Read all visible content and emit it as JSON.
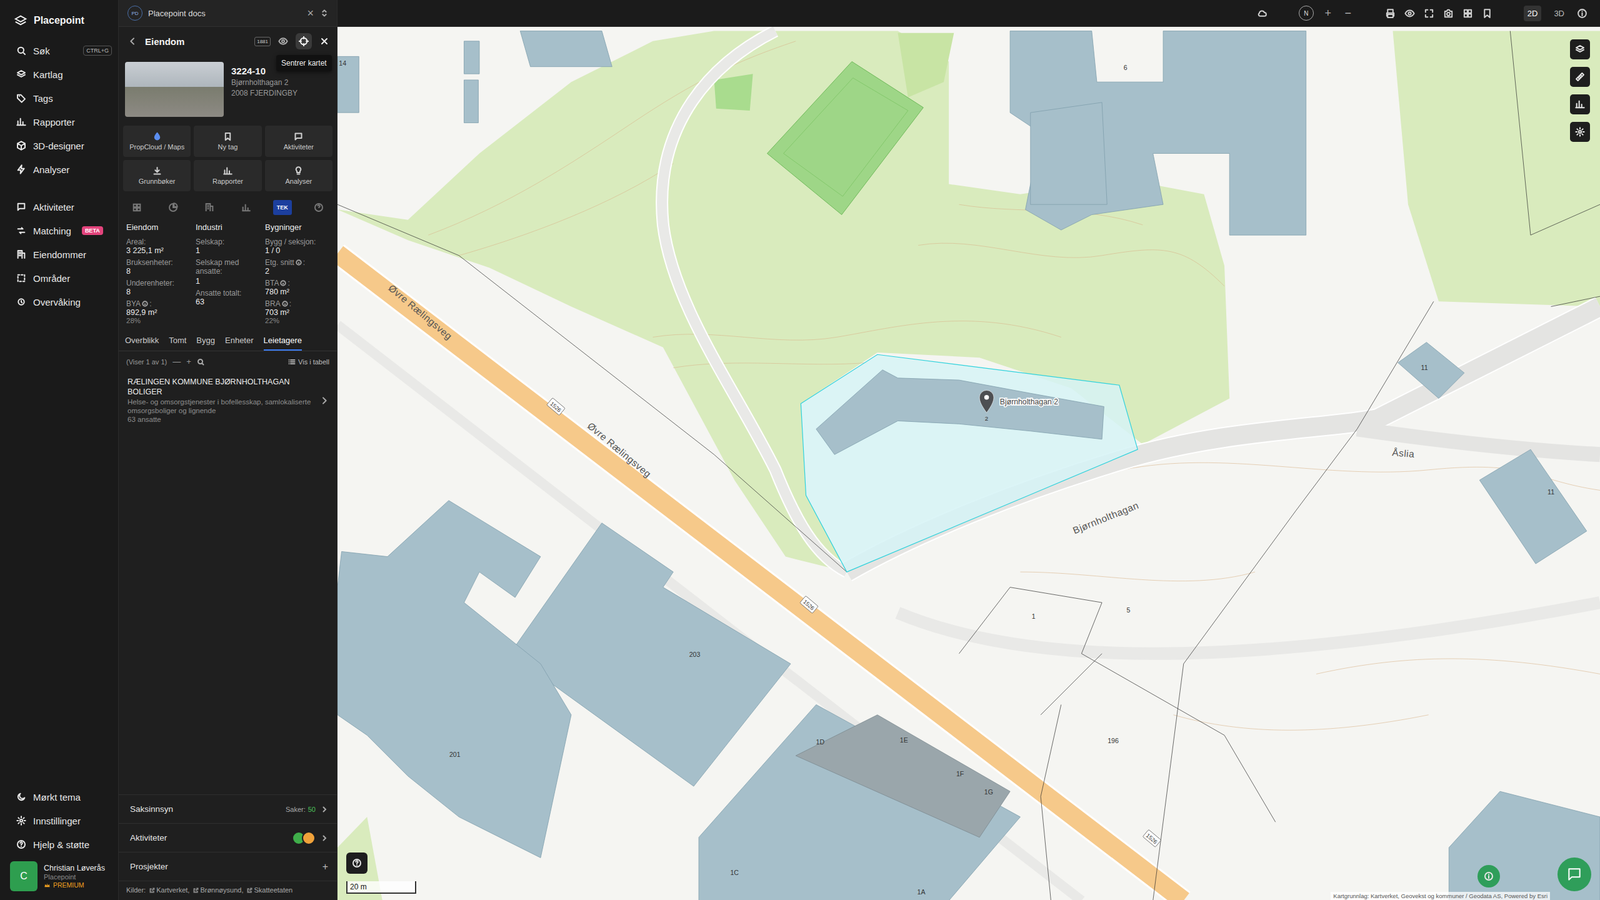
{
  "app": {
    "name": "Placepoint"
  },
  "nav": {
    "main": [
      {
        "label": "Søk",
        "shortcut": "CTRL+G",
        "selected": false
      },
      {
        "label": "Kartlag",
        "shortcut": "",
        "selected": false
      },
      {
        "label": "Tags",
        "shortcut": "",
        "selected": false
      },
      {
        "label": "Rapporter",
        "shortcut": "",
        "selected": false
      },
      {
        "label": "3D-designer",
        "shortcut": "",
        "selected": false
      },
      {
        "label": "Analyser",
        "shortcut": "",
        "selected": false
      }
    ],
    "secondary": [
      {
        "label": "Aktiviteter",
        "badge": "",
        "selected": false
      },
      {
        "label": "Matching",
        "badge": "BETA",
        "selected": false
      },
      {
        "label": "Eiendommer",
        "badge": "",
        "selected": false
      },
      {
        "label": "Områder",
        "badge": "",
        "selected": false
      },
      {
        "label": "Overvåking",
        "badge": "",
        "selected": false
      }
    ],
    "footer": [
      {
        "label": "Mørkt tema",
        "selected": false
      },
      {
        "label": "Innstillinger",
        "selected": false
      },
      {
        "label": "Hjelp & støtte",
        "selected": false
      }
    ],
    "user": {
      "initial": "C",
      "name": "Christian Løverås",
      "org": "Placepoint",
      "plan": "PREMIUM"
    }
  },
  "panel_tab": {
    "badge": "PD",
    "title": "Placepoint docs",
    "close": "×"
  },
  "header": {
    "title": "Eiendom",
    "badge": "1881",
    "tooltip": "Sentrer kartet"
  },
  "property": {
    "id": "3224-10",
    "address": "Bjørnholthagan 2",
    "postal": "2008 FJERDINGBY"
  },
  "actions": [
    {
      "label": "PropCloud / Maps"
    },
    {
      "label": "Ny tag"
    },
    {
      "label": "Aktiviteter"
    },
    {
      "label": "Grunnbøker"
    },
    {
      "label": "Rapporter"
    },
    {
      "label": "Analyser"
    }
  ],
  "source_tabs": [
    {
      "kind": "icon",
      "label": "",
      "selected": false
    },
    {
      "kind": "icon",
      "label": "",
      "selected": false
    },
    {
      "kind": "icon",
      "label": "",
      "selected": false
    },
    {
      "kind": "icon",
      "label": "",
      "selected": false
    },
    {
      "kind": "text",
      "label": "TEK",
      "selected": true
    },
    {
      "kind": "icon",
      "label": "",
      "selected": false
    }
  ],
  "stats": [
    {
      "title": "Eiendom",
      "rows": [
        {
          "label": "Areal:",
          "info": false,
          "after": "",
          "value": "3 225,1 m²",
          "sub": ""
        },
        {
          "label": "Bruksenheter:",
          "info": false,
          "after": "",
          "value": "8",
          "sub": ""
        },
        {
          "label": "Underenheter:",
          "info": false,
          "after": "",
          "value": "8",
          "sub": ""
        },
        {
          "label": "BYA",
          "info": true,
          "after": ":",
          "value": "892,9 m²",
          "sub": "28%"
        }
      ]
    },
    {
      "title": "Industri",
      "rows": [
        {
          "label": "Selskap:",
          "info": false,
          "after": "",
          "value": "1",
          "sub": ""
        },
        {
          "label": "Selskap med ansatte:",
          "info": false,
          "after": "",
          "value": "1",
          "sub": ""
        },
        {
          "label": "Ansatte totalt:",
          "info": false,
          "after": "",
          "value": "63",
          "sub": ""
        }
      ]
    },
    {
      "title": "Bygninger",
      "rows": [
        {
          "label": "Bygg / seksjon:",
          "info": false,
          "after": "",
          "value": "1 / 0",
          "sub": ""
        },
        {
          "label": "Etg. snitt",
          "info": true,
          "after": ":",
          "value": "2",
          "sub": ""
        },
        {
          "label": "BTA",
          "info": true,
          "after": ":",
          "value": "780 m²",
          "sub": ""
        },
        {
          "label": "BRA",
          "info": true,
          "after": ":",
          "value": "703 m²",
          "sub": "22%"
        }
      ]
    }
  ],
  "tabs": [
    {
      "label": "Overblikk",
      "selected": false
    },
    {
      "label": "Tomt",
      "selected": false
    },
    {
      "label": "Bygg",
      "selected": false
    },
    {
      "label": "Enheter",
      "selected": false
    },
    {
      "label": "Leietagere",
      "selected": true
    }
  ],
  "list": {
    "count": "(Viser 1 av 1)",
    "collapse": "—",
    "add": "+",
    "table_button": "Vis i tabell"
  },
  "tenants": [
    {
      "name": "RÆLINGEN KOMMUNE BJØRNHOLTHAGAN BOLIGER",
      "description": "Helse- og omsorgstjenester i bofellesskap, samlokaliserte omsorgsboliger og lignende",
      "employees": "63 ansatte"
    }
  ],
  "sections": [
    {
      "title": "Saksinnsyn",
      "kind": "count",
      "label": "Saker:",
      "value": "50",
      "action": "",
      "avatars": []
    },
    {
      "title": "Aktiviteter",
      "kind": "avatars",
      "label": "",
      "value": "",
      "action": "",
      "avatars": [
        {
          "color": "#3fae4a"
        },
        {
          "color": "#f0a23a"
        }
      ]
    },
    {
      "title": "Prosjekter",
      "kind": "add",
      "label": "",
      "value": "",
      "action": "+",
      "avatars": []
    }
  ],
  "sources": {
    "label": "Kilder:",
    "items": [
      "Kartverket,",
      "Brønnøysund,",
      "Skatteetaten"
    ]
  },
  "map_toolbar": {
    "compass": "N",
    "zoom_in": "+",
    "zoom_out": "−",
    "modes": [
      {
        "label": "2D",
        "selected": true
      },
      {
        "label": "3D",
        "selected": false
      }
    ]
  },
  "map": {
    "road_labels": [
      "Øvre Rælingsveg",
      "Øvre Rælingsveg",
      "Bjørnholthagan",
      "Åslia"
    ],
    "building_numbers": [
      "6",
      "11",
      "11",
      "203",
      "201",
      "1D",
      "1E",
      "1F",
      "1G",
      "1C",
      "1A",
      "196",
      "1",
      "5",
      "14"
    ],
    "road_shields": [
      "1526",
      "1526",
      "1526"
    ],
    "pin_label": "Bjørnholthagan 2",
    "pin_number": "2",
    "scale": "20 m",
    "attribution": "Kartgrunnlag: Kartverket, Geovekst og kommuner / Geodata AS, Powered by Esri"
  }
}
